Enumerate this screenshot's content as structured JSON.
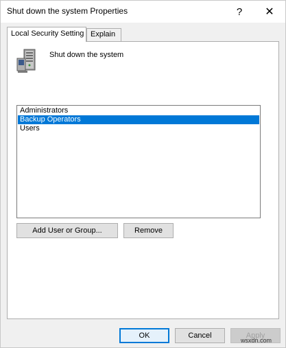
{
  "window": {
    "title": "Shut down the system Properties",
    "help_glyph": "?",
    "close_glyph": "✕"
  },
  "tabs": [
    {
      "label": "Local Security Setting",
      "active": true
    },
    {
      "label": "Explain",
      "active": false
    }
  ],
  "policy": {
    "name": "Shut down the system",
    "icon": "server-computer-icon"
  },
  "list": {
    "items": [
      {
        "label": "Administrators",
        "selected": false
      },
      {
        "label": "Backup Operators",
        "selected": true
      },
      {
        "label": "Users",
        "selected": false
      }
    ]
  },
  "buttons": {
    "add": "Add User or Group...",
    "remove": "Remove",
    "ok": "OK",
    "cancel": "Cancel",
    "apply": "Apply"
  },
  "watermark": "wsxdn.com",
  "colors": {
    "accent": "#0078d7",
    "panel_bg": "#ffffff",
    "window_bg": "#f0f0f0"
  }
}
